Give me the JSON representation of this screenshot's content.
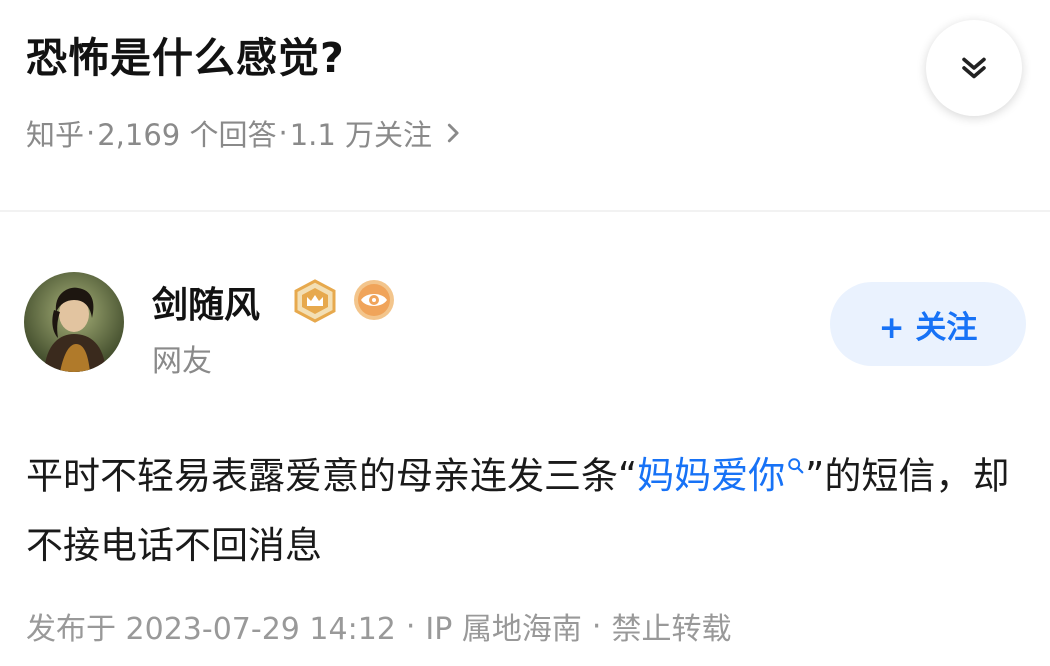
{
  "question": {
    "title": "恐怖是什么感觉?",
    "source": "知乎",
    "answers_count": "2,169 个回答",
    "followers": "1.1 万关注",
    "separator": "·"
  },
  "author": {
    "name": "剑随风",
    "subtitle": "网友",
    "follow_label": "+ 关注"
  },
  "answer": {
    "text_before": "平时不轻易表露爱意的母亲连发三条“",
    "keyword": "妈妈爱你",
    "text_after": "”的短信，却不接电话不回消息"
  },
  "footer": {
    "published": "发布于 2023-07-29 14:12",
    "ip": "IP 属地海南",
    "repost": "禁止转载",
    "separator": "·"
  },
  "colors": {
    "accent": "#1772f6",
    "follow_bg": "#eaf2fe",
    "meta_text": "#8a8a8a",
    "badge_gold": "#e7a94d",
    "badge_orange": "#f0a45a"
  },
  "icons": {
    "collapse": "double-chevron-down-icon",
    "meta_arrow": "chevron-right-icon",
    "badge_1": "crown-hexagon-badge-icon",
    "badge_2": "eye-badge-icon",
    "keyword_search": "search-icon"
  }
}
